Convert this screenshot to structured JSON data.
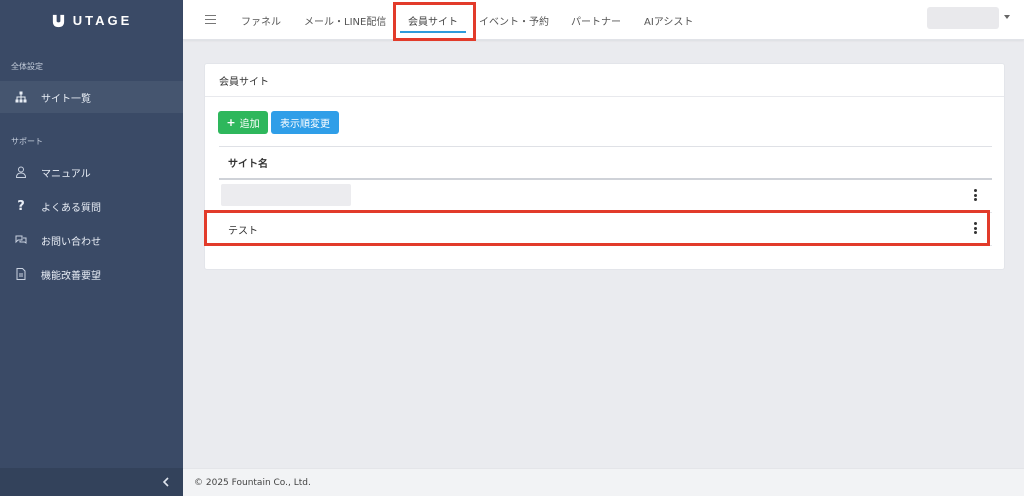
{
  "brand": {
    "name": "UTAGE"
  },
  "sidebar": {
    "section1_label": "全体設定",
    "section2_label": "サポート",
    "items": [
      {
        "label": "サイト一覧",
        "icon": "sitemap-icon",
        "active": true
      },
      {
        "label": "マニュアル",
        "icon": "user-icon",
        "active": false
      },
      {
        "label": "よくある質問",
        "icon": "question-icon",
        "active": false
      },
      {
        "label": "お問い合わせ",
        "icon": "chat-icon",
        "active": false
      },
      {
        "label": "機能改善要望",
        "icon": "document-icon",
        "active": false
      }
    ],
    "collapse_icon": "chevron-left-icon"
  },
  "topnav": {
    "menu_icon": "hamburger-icon",
    "tabs": [
      {
        "label": "ファネル"
      },
      {
        "label": "メール・LINE配信"
      },
      {
        "label": "会員サイト",
        "active": true
      },
      {
        "label": "イベント・予約"
      },
      {
        "label": "パートナー"
      },
      {
        "label": "AIアシスト"
      }
    ]
  },
  "main": {
    "card_title": "会員サイト",
    "add_button": {
      "icon": "+",
      "label": "追加"
    },
    "order_button": {
      "label": "表示順変更"
    },
    "table": {
      "column_header": "サイト名",
      "rows": [
        {
          "name": ""
        },
        {
          "name": "テスト"
        }
      ]
    }
  },
  "footer": {
    "copyright": "© 2025 Fountain Co., Ltd."
  },
  "colors": {
    "sidebar_bg": "#3a4a66",
    "accent": "#2e9cdb",
    "add_button": "#2eb75c",
    "order_button": "#2f9ee8",
    "highlight": "#e23b2a"
  }
}
